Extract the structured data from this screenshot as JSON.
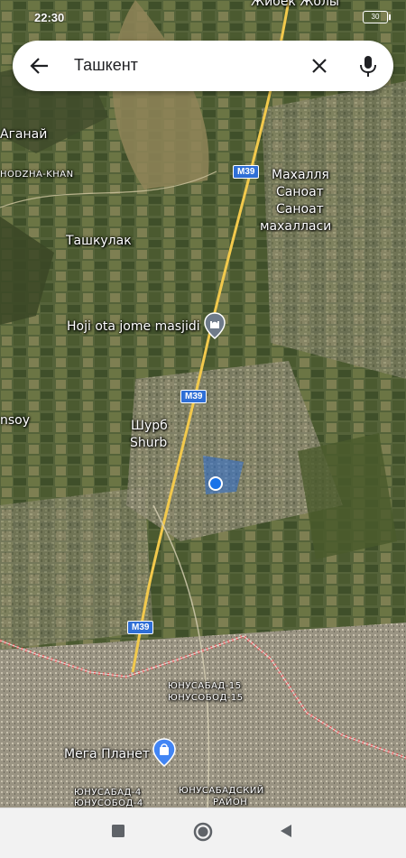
{
  "status_bar": {
    "time": "22:30",
    "battery": "30",
    "top_clipped_label": "Жибек Жолы"
  },
  "search": {
    "query": "Ташкент",
    "back_icon": "arrow-left-icon",
    "clear_icon": "close-icon",
    "voice_icon": "mic-icon"
  },
  "map": {
    "labels": {
      "aganai": "Аганай",
      "hodzha_khan": "HODZHA-KHAN",
      "mahallya": "Махалля",
      "sanoat1": "Саноат",
      "sanoat2": "Саноат",
      "mahallasi": "махалласи",
      "tashkulak": "Ташкулак",
      "hoji": "Hoji ota jome masjidi",
      "ansoy": "nsoy",
      "shurb_cyr": "Шурб",
      "shurb_lat": "Shurb",
      "yunusabad15": "ЮНУСАБАД-15",
      "yunusobod15": "ЮНУСОБОД-15",
      "mega": "Мега Планет",
      "yunusabad4": "ЮНУСАБАД-4",
      "yunusobod4": "ЮНУСОБОД-4",
      "yunusabad_district": "ЮНУСАБАДСКИЙ",
      "rayon": "РАЙОН"
    },
    "highway_shields": [
      "M39",
      "M39",
      "M39"
    ],
    "colors": {
      "location_dot": "#1a73e8",
      "border_line": "#e04a4a",
      "highway": "#f2c94c",
      "shield": "#2f6fd6"
    }
  },
  "nav_bar": {
    "recent_icon": "square-recents-icon",
    "home_icon": "circle-home-icon",
    "back_icon": "triangle-back-icon"
  }
}
